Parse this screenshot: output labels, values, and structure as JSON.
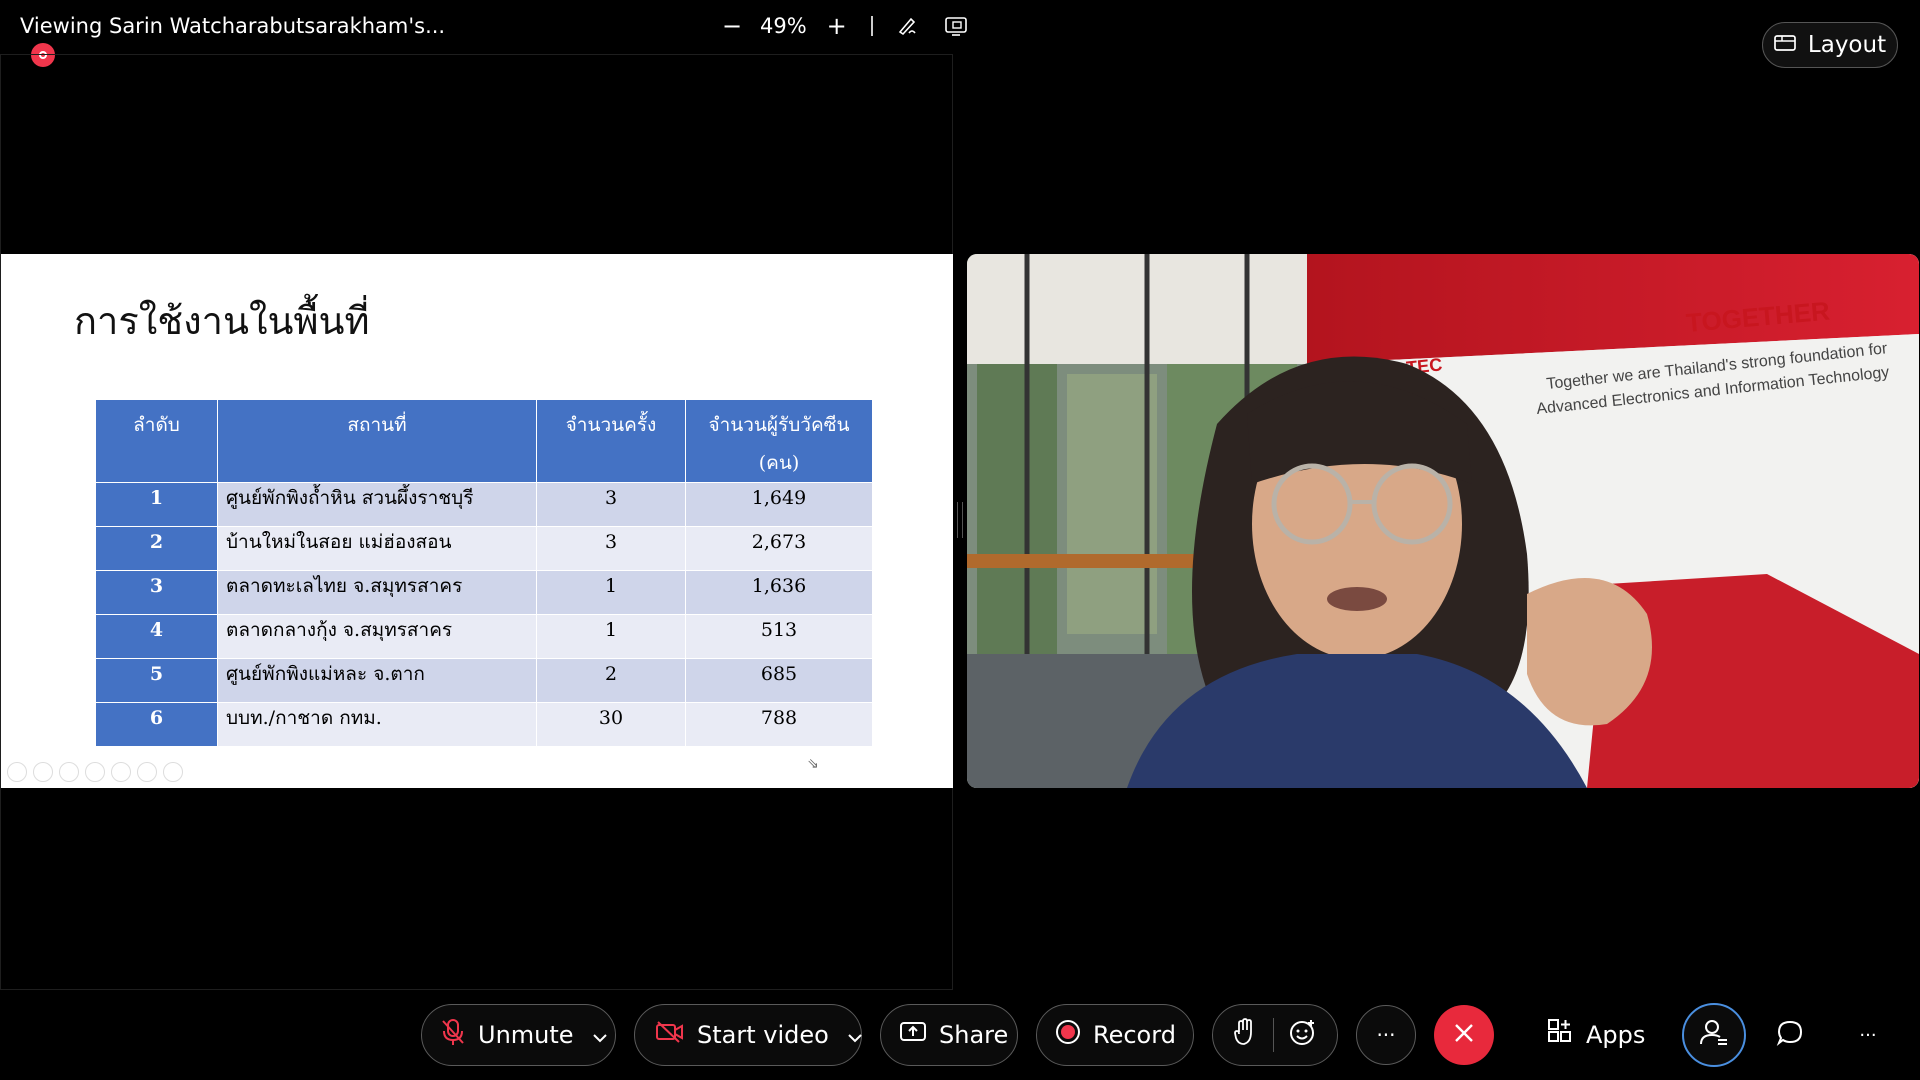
{
  "share_bar": {
    "title": "Viewing Sarin Watcharabutsarakham's...",
    "zoom_out": "−",
    "zoom_value": "49%",
    "zoom_in": "+",
    "annotate_icon": "annotate-pen-icon",
    "fit_icon": "fit-screen-icon"
  },
  "layout_button": {
    "label": "Layout",
    "icon": "layout-icon"
  },
  "slide": {
    "title": "การใช้งานในพื้นที่",
    "headers": [
      "ลำดับ",
      "สถานที่",
      "จำนวนครั้ง",
      "จำนวนผู้รับวัคซีน",
      "(คน)"
    ],
    "rows": [
      {
        "no": "1",
        "place": "ศูนย์พักพิงถ้ำหิน สวนผึ้งราชบุรี",
        "times": "3",
        "people": "1,649"
      },
      {
        "no": "2",
        "place": "บ้านใหม่ในสอย แม่ฮ่องสอน",
        "times": "3",
        "people": "2,673"
      },
      {
        "no": "3",
        "place": "ตลาดทะเลไทย  จ.สมุทรสาคร",
        "times": "1",
        "people": "1,636"
      },
      {
        "no": "4",
        "place": "ตลาดกลางกุ้ง จ.สมุทรสาคร",
        "times": "1",
        "people": "513"
      },
      {
        "no": "5",
        "place": "ศูนย์พักพิงแม่หละ จ.ตาก",
        "times": "2",
        "people": "685"
      },
      {
        "no": "6",
        "place": "บบท./กาชาด กทม.",
        "times": "30",
        "people": "788"
      }
    ]
  },
  "video": {
    "sign_brand": "TOGETHER",
    "sign_line1": "Together we are Thailand's strong foundation for",
    "sign_line2": "Advanced Electronics and Information Technology",
    "logo_fragment": "TEC"
  },
  "toolbar": {
    "unmute": "Unmute",
    "start_video": "Start video",
    "share": "Share",
    "record": "Record",
    "more": "···",
    "apps": "Apps",
    "overflow": "···"
  },
  "colors": {
    "accent_red": "#e8293c",
    "table_header": "#4472c4",
    "row_odd": "#cfd5ea",
    "row_even": "#e9ebf5"
  }
}
